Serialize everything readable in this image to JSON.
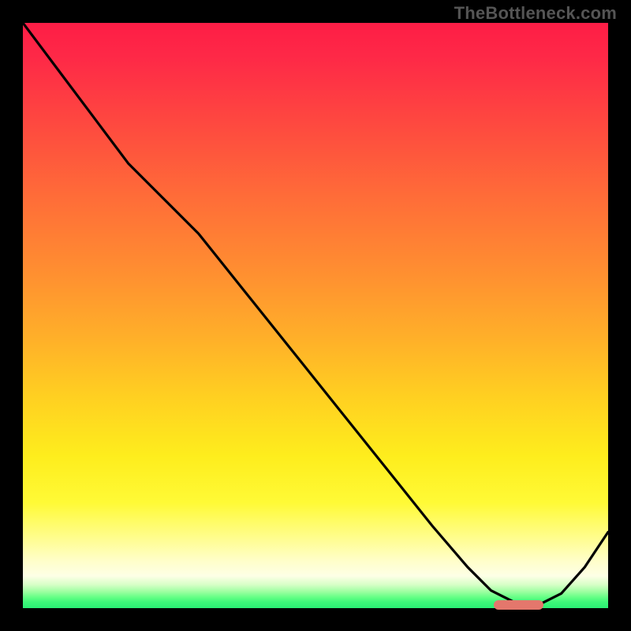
{
  "watermark": "TheBottleneck.com",
  "colors": {
    "page_bg": "#000000",
    "watermark_text": "#555555",
    "curve": "#000000",
    "marker": "#e4776c"
  },
  "chart_data": {
    "type": "line",
    "title": "",
    "xlabel": "",
    "ylabel": "",
    "xlim": [
      0,
      100
    ],
    "ylim": [
      0,
      100
    ],
    "grid": false,
    "legend": false,
    "series": [
      {
        "name": "curve",
        "x": [
          0,
          6,
          12,
          18,
          24,
          30,
          38,
          46,
          54,
          62,
          70,
          76,
          80,
          84,
          88,
          92,
          96,
          100
        ],
        "y": [
          100,
          92,
          84,
          76,
          70,
          64,
          54,
          44,
          34,
          24,
          14,
          7,
          3,
          1,
          0.5,
          2.5,
          7,
          13
        ]
      }
    ],
    "marker": {
      "x_start": 80.5,
      "x_end": 89.0,
      "y": 0.5
    },
    "background_gradient": {
      "top": "#fe1d46",
      "bottom": "#2bef74"
    }
  }
}
